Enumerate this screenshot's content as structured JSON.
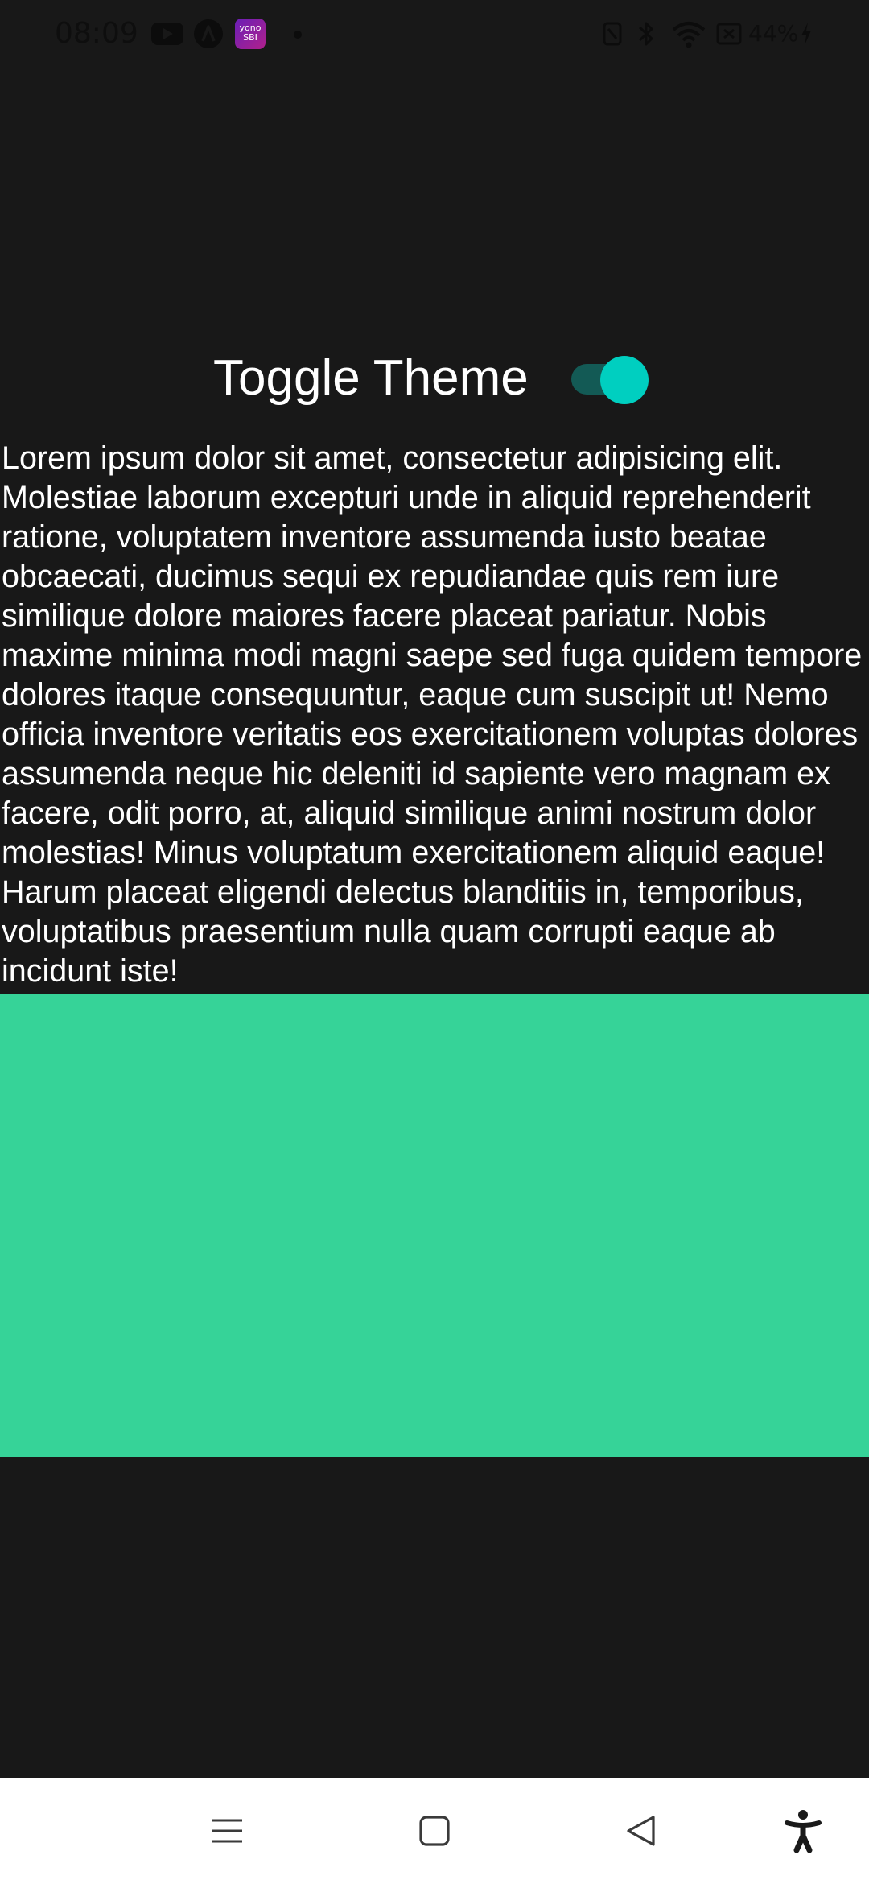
{
  "status_bar": {
    "time": "08:09",
    "battery": "44%",
    "yono_line1": "yono",
    "yono_line2": "SBI",
    "icons": [
      "youtube-icon",
      "a-app-icon",
      "yono-sbi-icon",
      "notification-dot-icon",
      "nfc-icon",
      "bluetooth-icon",
      "wifi-icon",
      "sim-icon",
      "charging-icon"
    ]
  },
  "toggle": {
    "label": "Toggle Theme",
    "state": "on",
    "track_color": "#135a55",
    "thumb_color": "#00cfc0"
  },
  "content": {
    "paragraph": "Lorem ipsum dolor sit amet, consectetur adipisicing elit. Molestiae laborum excepturi unde in aliquid reprehenderit ratione, voluptatem inventore assumenda iusto beatae obcaecati, ducimus sequi ex repudiandae quis rem iure similique dolore maiores facere placeat pariatur. Nobis maxime minima modi magni saepe sed fuga quidem tempore dolores itaque consequuntur, eaque cum suscipit ut! Nemo officia inventore veritatis eos exercitationem voluptas dolores assumenda neque hic deleniti id sapiente vero magnam ex facere, odit porro, at, aliquid similique animi nostrum dolor molestias! Minus voluptatum exercitationem aliquid eaque! Harum placeat eligendi delectus blanditiis in, temporibus, voluptatibus praesentium nulla quam corrupti eaque ab incidunt iste!",
    "block_color": "#36d398",
    "background_color": "#181818"
  },
  "nav_bar": {
    "buttons": [
      "menu-icon",
      "home-icon",
      "back-icon",
      "accessibility-icon"
    ]
  }
}
